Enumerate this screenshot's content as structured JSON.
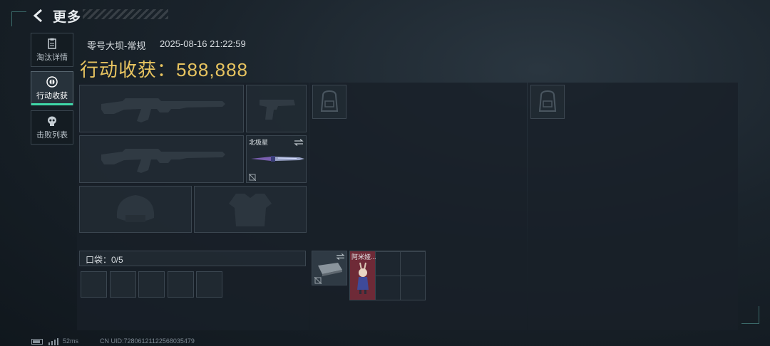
{
  "header": {
    "title": "更多",
    "back_icon": "chevron-left-icon"
  },
  "sidebar": {
    "items": [
      {
        "label": "淘汰详情",
        "icon": "clipboard-icon",
        "active": false
      },
      {
        "label": "行动收获",
        "icon": "target-icon",
        "active": true
      },
      {
        "label": "击败列表",
        "icon": "skull-icon",
        "active": false
      }
    ],
    "accent": "#3fd8a8"
  },
  "match": {
    "map": "零号大坝-常规",
    "datetime": "2025-08-16 21:22:59",
    "haul_label": "行动收获：",
    "haul_value": "588,888",
    "haul_color": "#e8c460"
  },
  "loadout": {
    "primary_weapon": "assault-rifle-silhouette",
    "pistol": "pistol-silhouette",
    "secondary_weapon": "assault-rifle-silhouette",
    "melee": {
      "label": "北极星",
      "icon": "knife-icon"
    },
    "helmet": "helmet-silhouette",
    "armor": "armor-vest-silhouette",
    "pocket": {
      "label": "口袋：0/5",
      "slots": 5
    }
  },
  "mid_panel": {
    "backpack_icon": "backpack-icon",
    "items": [
      {
        "label": "",
        "icon": "keycard-case-icon"
      },
      {
        "label": "阿米娅...",
        "icon": "figure-icon"
      }
    ]
  },
  "right_panel": {
    "backpack_icon": "backpack-icon"
  },
  "footer": {
    "ping": "52ms",
    "uid": "CN UID:7280612112256803547​9"
  }
}
